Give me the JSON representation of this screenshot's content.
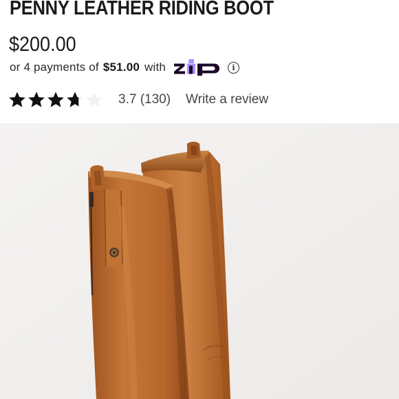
{
  "product": {
    "title": "PENNY LEATHER RIDING BOOT",
    "price": "$200.00"
  },
  "installments": {
    "prefix": "or 4 payments of",
    "amount": "$51.00",
    "suffix": "with",
    "provider": "zip",
    "logo_color_dark": "#1a0826",
    "logo_color_accent": "#aa8fff",
    "info_glyph": "i"
  },
  "rating": {
    "value": 3.7,
    "stars_max": 5,
    "summary": "3.7 (130)",
    "review_label": "Write a review",
    "star_color": "#111111",
    "star_empty_color": "#f1f1f1"
  },
  "image": {
    "alt": "Penny leather riding boot in cognac",
    "background": "#f3f1f0",
    "boot_color": "#b8682e"
  }
}
